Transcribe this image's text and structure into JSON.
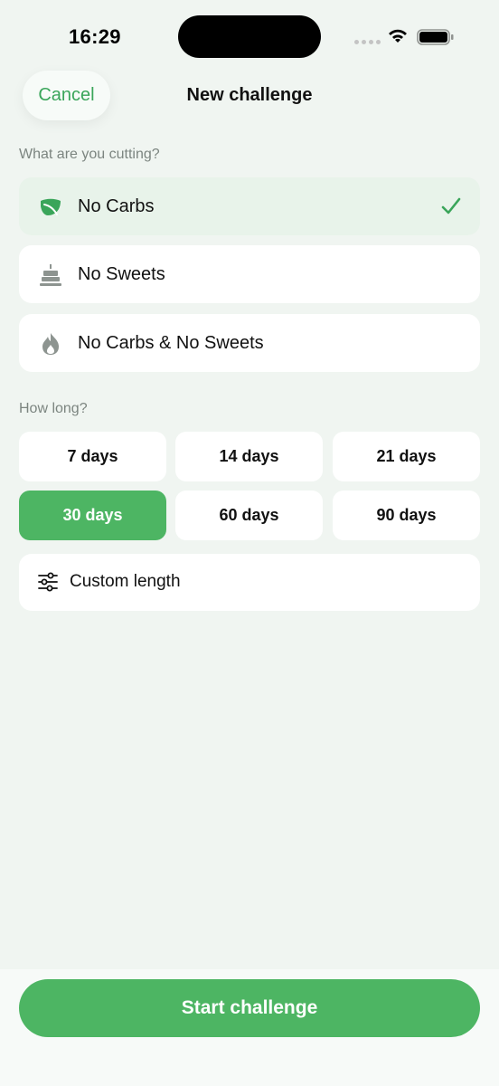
{
  "status_bar": {
    "time": "16:29"
  },
  "nav": {
    "cancel_label": "Cancel",
    "title": "New challenge"
  },
  "cut_section": {
    "label": "What are you cutting?",
    "options": [
      {
        "label": "No Carbs",
        "icon": "leaf-icon",
        "selected": true
      },
      {
        "label": "No Sweets",
        "icon": "cake-icon",
        "selected": false
      },
      {
        "label": "No Carbs & No Sweets",
        "icon": "flame-icon",
        "selected": false
      }
    ]
  },
  "length_section": {
    "label": "How long?",
    "durations": [
      "7 days",
      "14 days",
      "21 days",
      "30 days",
      "60 days",
      "90 days"
    ],
    "selected": "30 days",
    "custom_label": "Custom length"
  },
  "footer": {
    "start_label": "Start challenge"
  },
  "colors": {
    "accent": "#4db563",
    "accent_text": "#3aa55a",
    "selected_bg": "#e8f3ea",
    "background": "#f0f5f1"
  }
}
